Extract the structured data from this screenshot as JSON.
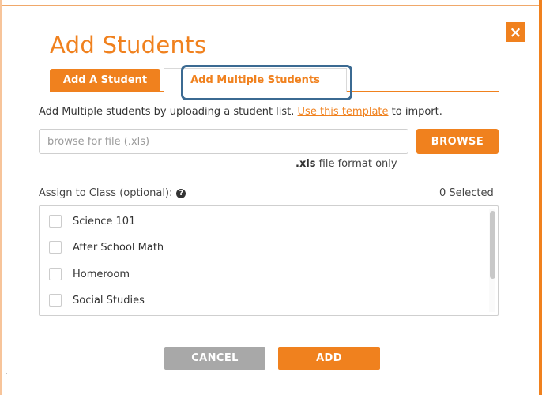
{
  "modal": {
    "title": "Add Students",
    "close_glyph": "×"
  },
  "tabs": [
    {
      "label": "Add A Student",
      "active": false
    },
    {
      "label": "Add Multiple Students",
      "active": true
    }
  ],
  "description": {
    "prefix": "Add Multiple students by uploading a student list. ",
    "link": "Use this template",
    "suffix": " to import."
  },
  "file_upload": {
    "value": "",
    "placeholder": "browse for file (.xls)",
    "browse_label": "BROWSE",
    "format_ext": ".xls",
    "format_note": " file format only"
  },
  "assign": {
    "label": "Assign to Class (optional):",
    "help_icon": "question-circle-icon",
    "selected": "0 Selected"
  },
  "classes": [
    {
      "name": "Science 101",
      "checked": false
    },
    {
      "name": "After School Math",
      "checked": false
    },
    {
      "name": "Homeroom",
      "checked": false
    },
    {
      "name": "Social Studies",
      "checked": false
    }
  ],
  "actions": {
    "cancel": "CANCEL",
    "add": "ADD"
  },
  "colors": {
    "accent": "#f0811e",
    "highlight": "#3b6a92",
    "cancel": "#a8a8a8"
  },
  "misc": {
    "dot": "."
  }
}
